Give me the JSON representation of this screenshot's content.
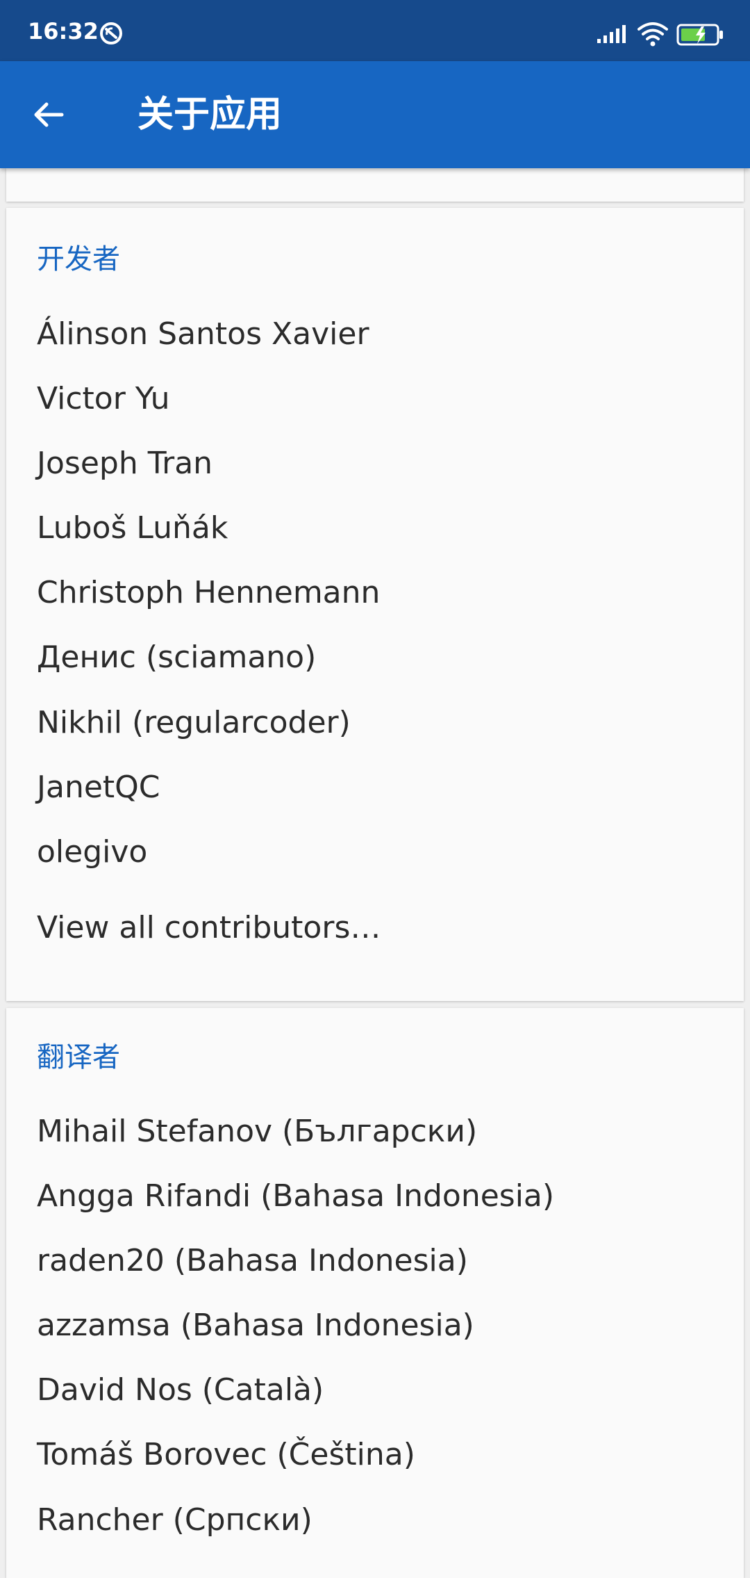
{
  "status_bar": {
    "time": "16:32"
  },
  "app_bar": {
    "title": "关于应用"
  },
  "developers": {
    "title": "开发者",
    "items": [
      "Álinson Santos Xavier",
      "Victor Yu",
      "Joseph Tran",
      "Luboš Luňák",
      "Christoph Hennemann",
      "Денис (sciamano)",
      "Nikhil (regularcoder)",
      "JanetQC",
      "olegivo"
    ],
    "view_all": "View all contributors…"
  },
  "translators": {
    "title": "翻译者",
    "items": [
      "Mihail Stefanov (Български)",
      "Angga Rifandi (Bahasa Indonesia)",
      "raden20 (Bahasa Indonesia)",
      "azzamsa (Bahasa Indonesia)",
      "David Nos (Català)",
      "Tomáš Borovec (Čeština)",
      "Rancher (Српски)"
    ]
  },
  "colors": {
    "status_bar": "#164a8c",
    "app_bar": "#1766c2",
    "accent": "#1766c2",
    "card": "#fafafa"
  },
  "icons": {
    "back": "arrow-left-icon",
    "sync": "sync-icon",
    "signal": "signal-icon",
    "wifi": "wifi-icon",
    "battery": "battery-charging-icon"
  }
}
